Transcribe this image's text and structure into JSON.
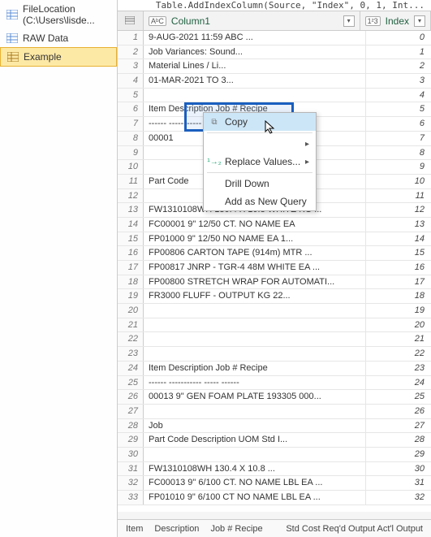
{
  "nav": {
    "items": [
      {
        "label": "FileLocation (C:\\Users\\lisde..."
      },
      {
        "label": "RAW Data"
      },
      {
        "label": "Example"
      }
    ]
  },
  "formula": "Table.AddIndexColumn(Source, \"Index\", 0, 1, Int...",
  "columns": {
    "col1": {
      "type": "AᵇC",
      "name": "Column1"
    },
    "col2": {
      "type": "1²3",
      "name": "Index"
    }
  },
  "rows": [
    {
      "n": "1",
      "a": "9-AUG-2021 11:59                        ABC ...",
      "b": "0"
    },
    {
      "n": "2",
      "a": "                            Job Variances: Sound...",
      "b": "1"
    },
    {
      "n": "3",
      "a": "                              Material Lines / Li...",
      "b": "2"
    },
    {
      "n": "4",
      "a": "                              01-MAR-2021 TO 3...",
      "b": "3"
    },
    {
      "n": "5",
      "a": "",
      "b": "4"
    },
    {
      "n": "6",
      "a": "Item     Description        Job #  Recipe",
      "b": "5"
    },
    {
      "n": "7",
      "a": "------     -----------        -----  ------",
      "b": "6"
    },
    {
      "n": "8",
      "a": "00001",
      "b": "7"
    },
    {
      "n": "9",
      "a": "",
      "b": "8"
    },
    {
      "n": "10",
      "a": "",
      "b": "9"
    },
    {
      "n": "11",
      "a": "   Part Code",
      "b": "10"
    },
    {
      "n": "12",
      "a": "",
      "b": "11"
    },
    {
      "n": "13",
      "a": "   FW1310108WH   130.4 X 10.8      WHITE KG   ...",
      "b": "12"
    },
    {
      "n": "14",
      "a": "   FC00001   9\" 12/50 CT. NO NAME   EA",
      "b": "13"
    },
    {
      "n": "15",
      "a": "   FP01000   9\" 12/50 NO NAME     EA    1...",
      "b": "14"
    },
    {
      "n": "16",
      "a": "   FP00806   CARTON TAPE (914m)    MTR  ...",
      "b": "15"
    },
    {
      "n": "17",
      "a": "   FP00817   JNRP - TGR-4 48M WHITE   EA  ...",
      "b": "16"
    },
    {
      "n": "18",
      "a": "   FP00800   STRETCH WRAP FOR AUTOMATI...",
      "b": "17"
    },
    {
      "n": "19",
      "a": "   FR3000    FLUFF - OUTPUT     KG    22...",
      "b": "18"
    },
    {
      "n": "20",
      "a": "",
      "b": "19"
    },
    {
      "n": "21",
      "a": "",
      "b": "20"
    },
    {
      "n": "22",
      "a": "",
      "b": "21"
    },
    {
      "n": "23",
      "a": "",
      "b": "22"
    },
    {
      "n": "24",
      "a": "Item     Description        Job #  Recipe",
      "b": "23"
    },
    {
      "n": "25",
      "a": "------     -----------        -----  ------",
      "b": "24"
    },
    {
      "n": "26",
      "a": "00013   9\" GEN FOAM PLATE     193305 000...",
      "b": "25"
    },
    {
      "n": "27",
      "a": "",
      "b": "26"
    },
    {
      "n": "28",
      "a": "                                Job",
      "b": "27"
    },
    {
      "n": "29",
      "a": "   Part Code   Description       UOM   Std I...",
      "b": "28"
    },
    {
      "n": "30",
      "a": "",
      "b": "29"
    },
    {
      "n": "31",
      "a": "   FW1310108WH   130.4 X 10.8     ...",
      "b": "30"
    },
    {
      "n": "32",
      "a": "   FC00013   9\" 6/100 CT. NO NAME LBL  EA   ...",
      "b": "31"
    },
    {
      "n": "33",
      "a": "   FP01010   9\" 6/100 CT NO NAME LBL  EA   ...",
      "b": "32"
    }
  ],
  "context_menu": {
    "copy": "Copy",
    "replace": "Replace Values...",
    "drill": "Drill Down",
    "addquery": "Add as New Query"
  },
  "status": {
    "segs": [
      "Item",
      "Description",
      "Job #  Recipe",
      "Std Cost Req'd Output Act'l Output"
    ]
  }
}
